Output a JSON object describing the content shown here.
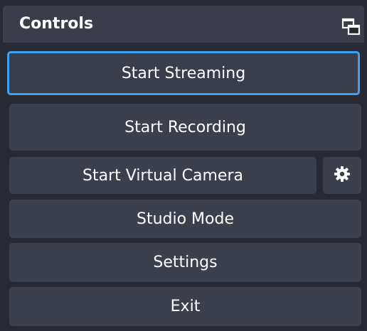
{
  "header": {
    "title": "Controls",
    "undock_icon": "undock-windows-icon"
  },
  "buttons": {
    "start_streaming": "Start Streaming",
    "start_recording": "Start Recording",
    "start_virtual_camera": "Start Virtual Camera",
    "virtual_camera_settings_icon": "gear-icon",
    "studio_mode": "Studio Mode",
    "settings": "Settings",
    "exit": "Exit"
  },
  "colors": {
    "focus_ring": "#3fa2f0",
    "button_bg": "#3c404d",
    "header_bg": "#3b3e4a",
    "panel_bg": "#272a33"
  }
}
